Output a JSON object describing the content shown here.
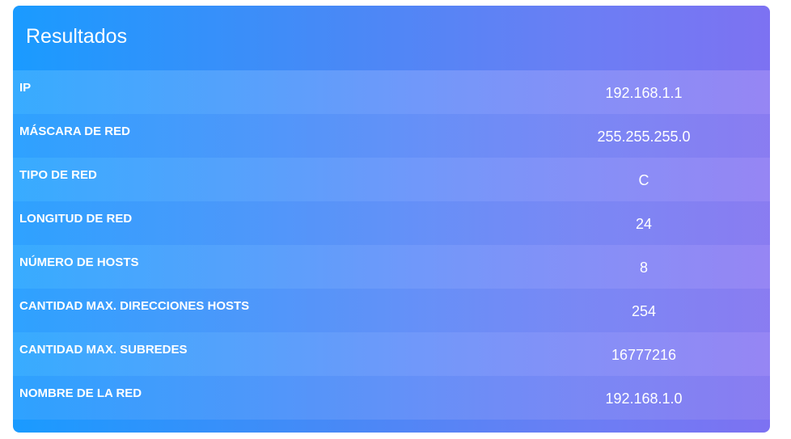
{
  "card": {
    "title": "Resultados"
  },
  "results": [
    {
      "label": "IP",
      "value": "192.168.1.1"
    },
    {
      "label": "MÁSCARA DE RED",
      "value": "255.255.255.0"
    },
    {
      "label": "TIPO DE RED",
      "value": "C"
    },
    {
      "label": "LONGITUD DE RED",
      "value": "24"
    },
    {
      "label": "NÚMERO DE HOSTS",
      "value": "8"
    },
    {
      "label": "CANTIDAD MAX. DIRECCIONES HOSTS",
      "value": "254"
    },
    {
      "label": "CANTIDAD MAX. SUBREDES",
      "value": "16777216"
    },
    {
      "label": "NOMBRE DE LA RED",
      "value": "192.168.1.0"
    }
  ],
  "colors": {
    "gradient_start": "#1a9bff",
    "gradient_end": "#7d72f2",
    "text": "#ffffff"
  }
}
